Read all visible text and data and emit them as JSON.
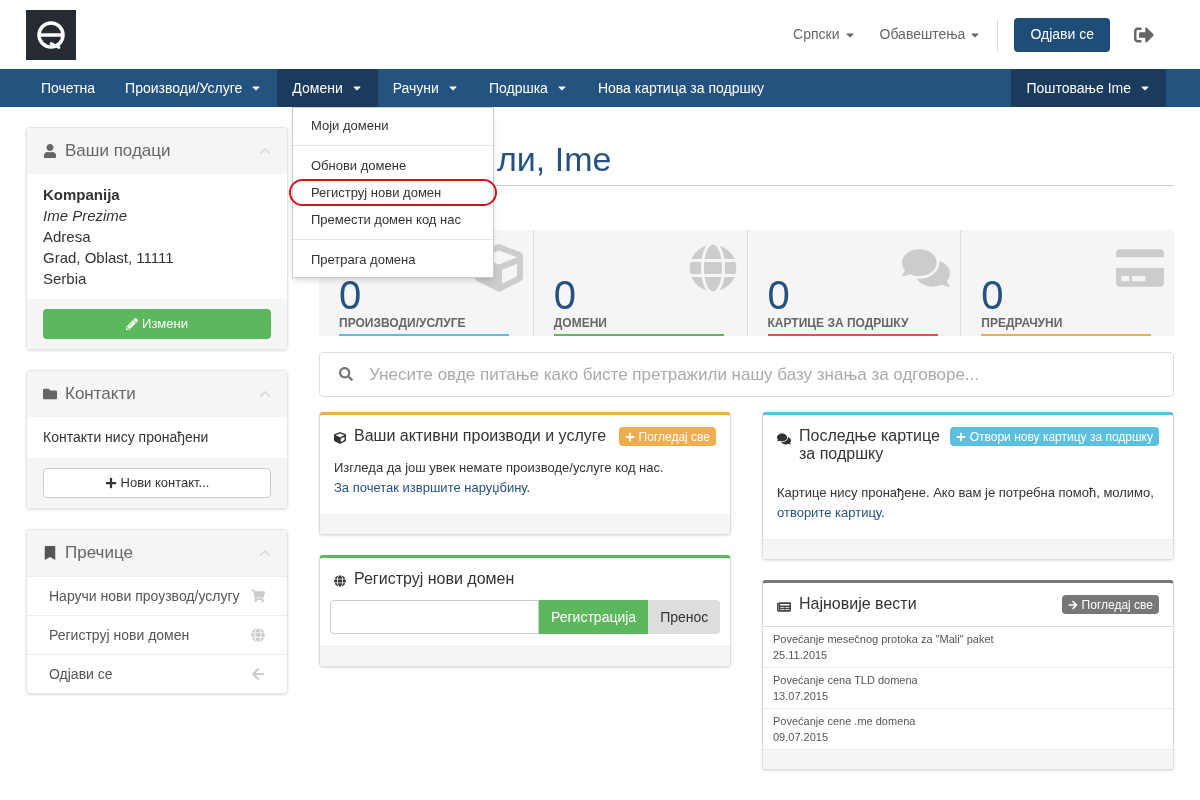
{
  "header": {
    "language": "Српски",
    "notifications": "Обавештења",
    "logout_button": "Одјави се"
  },
  "nav": {
    "items": [
      {
        "label": "Почетна",
        "has_caret": false,
        "selected": false
      },
      {
        "label": "Производи/Услуге",
        "has_caret": true,
        "selected": false
      },
      {
        "label": "Домени",
        "has_caret": true,
        "selected": true
      },
      {
        "label": "Рачуни",
        "has_caret": true,
        "selected": false
      },
      {
        "label": "Подршка",
        "has_caret": true,
        "selected": false
      },
      {
        "label": "Нова картица за подршку",
        "has_caret": false,
        "selected": false
      }
    ],
    "user_menu": "Поштовање Ime"
  },
  "dropdown_menu": {
    "groups": [
      [
        {
          "label": "Моји домени",
          "highlighted": false
        }
      ],
      [
        {
          "label": "Обнови домене",
          "highlighted": false
        },
        {
          "label": "Региструј нови домен",
          "highlighted": true
        },
        {
          "label": "Премести домен код нас",
          "highlighted": false
        }
      ],
      [
        {
          "label": "Претрага домена",
          "highlighted": false
        }
      ]
    ]
  },
  "sidebar": {
    "client_info": {
      "title": "Ваши подаци",
      "company": "Kompanija",
      "name": "Ime Prezime",
      "lines": [
        "Adresa",
        "Grad, Oblast, 11111",
        "Serbia"
      ],
      "button": "Измени"
    },
    "contacts": {
      "title": "Контакти",
      "empty": "Контакти нису пронађени",
      "button": "Нови контакт..."
    },
    "shortcuts": {
      "title": "Пречице",
      "items": [
        "Наручи нови проузвод/услугу",
        "Региструј нови домен",
        "Одјави се"
      ]
    }
  },
  "main": {
    "heading": "ли, Ime",
    "stats": [
      {
        "value": "0",
        "label": "ПРОИЗВОДИ/УСЛУГЕ",
        "color": "#5bc0de"
      },
      {
        "value": "0",
        "label": "ДОМЕНИ",
        "color": "#5cb85c"
      },
      {
        "value": "0",
        "label": "КАРТИЦЕ ЗА ПОДРШКУ",
        "color": "#d9534f"
      },
      {
        "value": "0",
        "label": "ПРЕДРАЧУНИ",
        "color": "#f0ad4e"
      }
    ],
    "search": {
      "placeholder": "Унесите овде питање како бисте претражили нашу базу знања за одговоре..."
    },
    "products_panel": {
      "title": "Ваши активни производи и услуге",
      "button": "Погледај све",
      "text": "Изгледа да још увек немате производе/услуге код нас.",
      "link": "За почетак извршите наруџбину",
      "after": ".",
      "color": "#f0ad4e"
    },
    "domain_panel": {
      "title": "Региструј нови домен",
      "register_button": "Регистрација",
      "transfer_button": "Пренос",
      "color": "#5cb85c"
    },
    "tickets_panel": {
      "title": "Последње картице за подршку",
      "button": "Отвори нову картицу за подршку",
      "text": "Картице нису пронађене. Ако вам је потребна помоћ, молимо,",
      "link": "отворите картицу",
      "after": ".",
      "color": "#5bc0de"
    },
    "news_panel": {
      "title": "Најновије вести",
      "button": "Погледај све",
      "color": "#777777",
      "items": [
        {
          "title": "Povećanje mesečnog protoka za \"Mali\" paket",
          "date": "25.11.2015"
        },
        {
          "title": "Povećanje cena TLD domena",
          "date": "13.07.2015"
        },
        {
          "title": "Povećanje cene .me domena",
          "date": "09.07.2015"
        }
      ]
    }
  }
}
